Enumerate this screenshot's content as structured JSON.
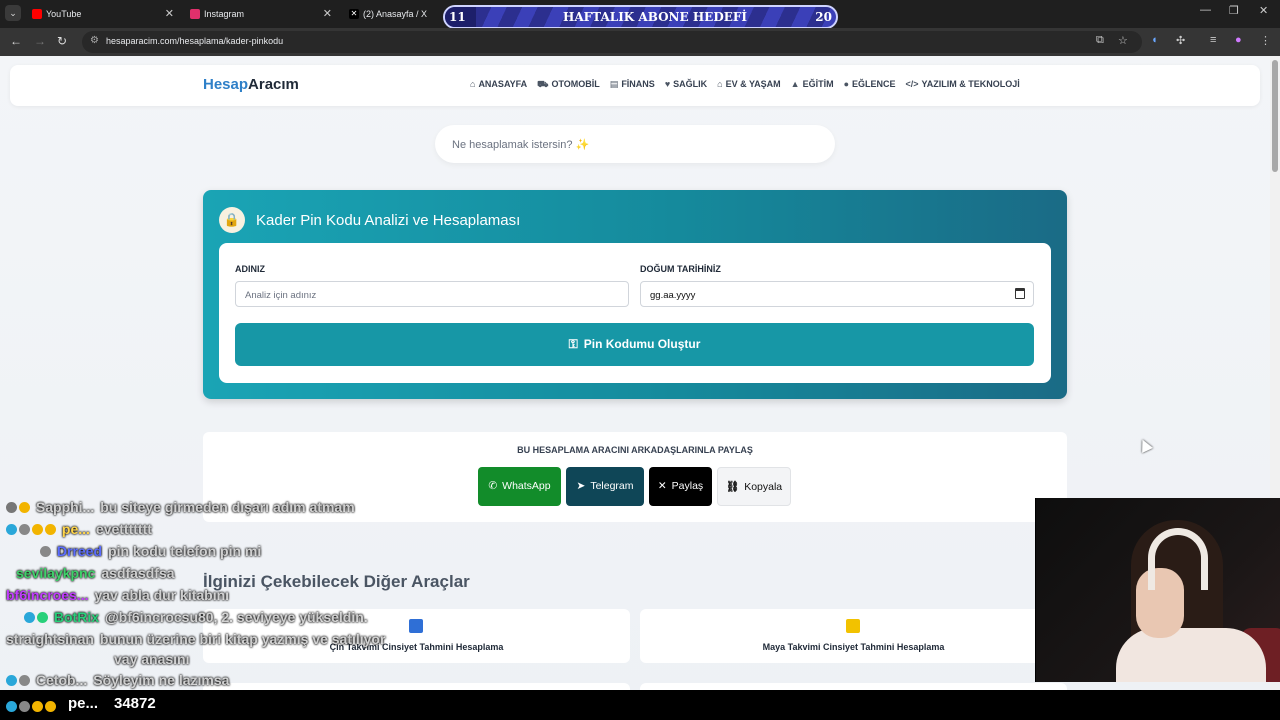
{
  "browser": {
    "tabs": [
      {
        "label": "YouTube",
        "favicon_color": "#ff0000"
      },
      {
        "label": "Instagram",
        "favicon_color": "#e1306c"
      },
      {
        "label": "(2) Anasayfa / X",
        "favicon_color": "#000000"
      }
    ],
    "url": "hesaparacim.com/hesaplama/kader-pinkodu"
  },
  "subgoal": {
    "current": "11",
    "title": "HAFTALIK ABONE HEDEFİ",
    "target": "20"
  },
  "site": {
    "logo_accent": "Hesap",
    "logo_rest": "Aracım",
    "nav": [
      {
        "icon": "house-icon",
        "glyph": "⌂",
        "label": "ANASAYFA"
      },
      {
        "icon": "car-icon",
        "glyph": "⛟",
        "label": "OTOMOBİL"
      },
      {
        "icon": "finance-icon",
        "glyph": "▤",
        "label": "FİNANS"
      },
      {
        "icon": "heart-icon",
        "glyph": "♥",
        "label": "SAĞLIK"
      },
      {
        "icon": "home-care-icon",
        "glyph": "⌂",
        "label": "EV & YAŞAM"
      },
      {
        "icon": "graduation-cap-icon",
        "glyph": "▲",
        "label": "EĞİTİM"
      },
      {
        "icon": "lightbulb-icon",
        "glyph": "●",
        "label": "EĞLENCE"
      },
      {
        "icon": "code-icon",
        "glyph": "</>",
        "label": "YAZILIM & TEKNOLOJİ"
      }
    ],
    "search_placeholder": "Ne hesaplamak istersin? ✨"
  },
  "calculator": {
    "title": "Kader Pin Kodu Analizi ve Hesaplaması",
    "name_label": "ADINIZ",
    "name_placeholder": "Analiz için adınız",
    "date_label": "DOĞUM TARİHİNİZ",
    "date_placeholder": "gg.aa.yyyy",
    "submit_label": "Pin Kodumu Oluştur"
  },
  "share": {
    "title": "BU HESAPLAMA ARACINI ARKADAŞLARINLA PAYLAŞ",
    "buttons": [
      {
        "label": "WhatsApp",
        "color": "#128c2a"
      },
      {
        "label": "Telegram",
        "color": "#0f4657"
      },
      {
        "label": "Paylaş",
        "color": "#000000"
      },
      {
        "label": "Kopyala",
        "color": "#f3f4f6"
      }
    ]
  },
  "related": {
    "title": "İlginizi Çekebilecek Diğer Araçlar",
    "items": [
      {
        "label": "Çin Takvimi Cinsiyet Tahmini Hesaplama",
        "icon_color": "#2f6fd6"
      },
      {
        "label": "Maya Takvimi Cinsiyet Tahmini Hesaplama",
        "icon_color": "#f2c200"
      }
    ]
  },
  "chat": {
    "messages": [
      {
        "user": "Sapphi...",
        "color": "#ffffff",
        "text": "bu siteye girmeden dışarı adım atmam"
      },
      {
        "user": "pe...",
        "color": "#ffd54a",
        "text": "evettttttt"
      },
      {
        "user": "Drreed",
        "color": "#5b6dff",
        "text": "pin kodu telefon pin mi"
      },
      {
        "user": "sevilaykpnc",
        "color": "#3fd16a",
        "text": "asdfasdfsa"
      },
      {
        "user": "bf6incroes...",
        "color": "#c23cff",
        "text": "yav abla dur kitabını"
      },
      {
        "user": "BotRix",
        "color": "#28d07a",
        "text": "@bf6incrocsu80, 2. seviyeye yükseldin."
      },
      {
        "user": "straightsinan",
        "color": "#ffffff",
        "text": "bunun üzerine biri kitap yazmış ve satılıyor"
      },
      {
        "user": "",
        "color": "#ffffff",
        "text": "vay anasını"
      },
      {
        "user": "Cetob...",
        "color": "#ffffff",
        "text": "Söyleyim ne lazımsa"
      },
      {
        "user": "pe...",
        "color": "#ffffff",
        "text": "34872"
      }
    ]
  }
}
